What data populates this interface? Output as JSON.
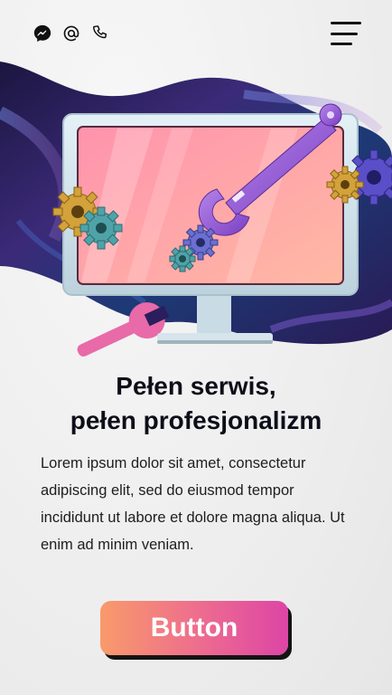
{
  "header": {
    "icons": [
      "messenger-icon",
      "at-icon",
      "phone-icon"
    ],
    "menu_icon": "hamburger-menu-icon"
  },
  "hero": {
    "illustration": "monitor-with-wrenches-and-gears",
    "colors": {
      "screen_pink": "#ff9fb0",
      "frame": "#d3e6ef",
      "wrench_purple": "#9a5fd6",
      "gear_gold": "#d3a23a",
      "gear_teal": "#4fa3a8",
      "blob_dark": "#2a1f5c"
    }
  },
  "content": {
    "headline_line1": "Pełen serwis,",
    "headline_line2": "pełen profesjonalizm",
    "body": "Lorem ipsum dolor sit amet, consectetur adipiscing elit, sed do eiusmod tempor incididunt ut labore et dolore magna aliqua. Ut enim ad minim veniam."
  },
  "cta": {
    "label": "Button",
    "gradient": [
      "#f99a6a",
      "#ee6f8d",
      "#dd45a5"
    ]
  }
}
